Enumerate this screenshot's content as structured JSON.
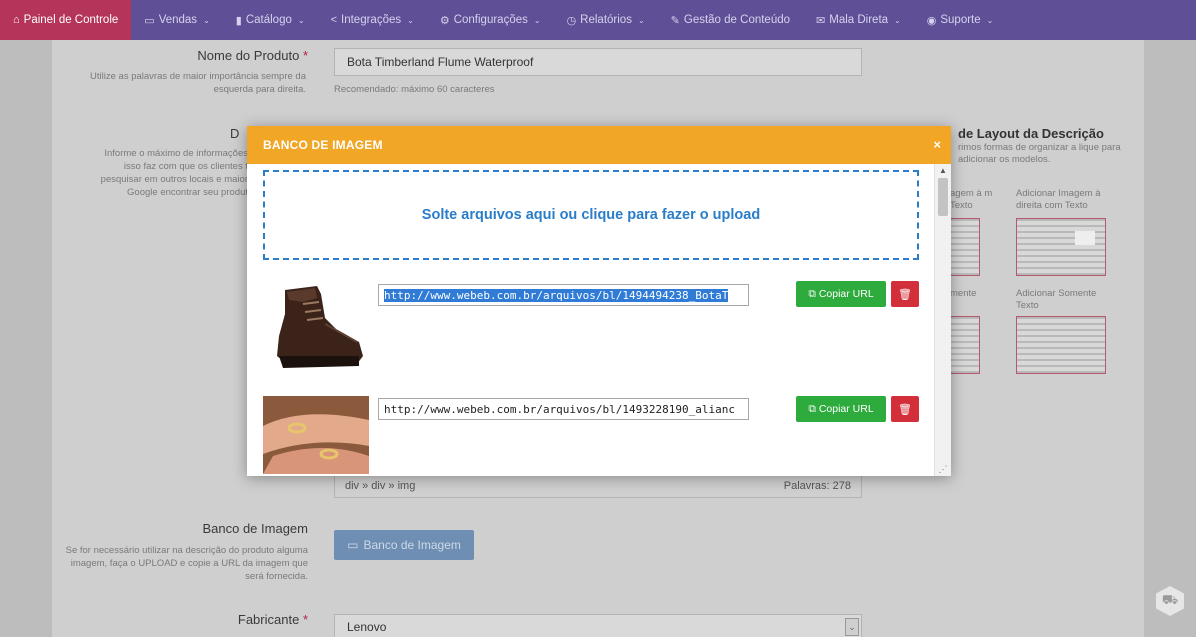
{
  "nav": {
    "items": [
      {
        "icon": "⌂",
        "label": "Painel de Controle",
        "caret": ""
      },
      {
        "icon": "▭",
        "label": "Vendas",
        "caret": "⌄"
      },
      {
        "icon": "▮",
        "label": "Catálogo",
        "caret": "⌄"
      },
      {
        "icon": "<",
        "label": "Integrações",
        "caret": "⌄"
      },
      {
        "icon": "⚙",
        "label": "Configurações",
        "caret": "⌄"
      },
      {
        "icon": "◷",
        "label": "Relatórios",
        "caret": "⌄"
      },
      {
        "icon": "✎",
        "label": "Gestão de Conteúdo",
        "caret": ""
      },
      {
        "icon": "✉",
        "label": "Mala Direta",
        "caret": "⌄"
      },
      {
        "icon": "◉",
        "label": "Suporte",
        "caret": "⌄"
      }
    ]
  },
  "form": {
    "product_name": {
      "label": "Nome do Produto",
      "required": "*",
      "hint": "Utilize as palavras de maior importância sempre da esquerda para direita.",
      "value": "Bota Timberland Flume Waterproof",
      "note": "Recomendado: máximo 60 caracteres"
    },
    "description": {
      "label_fragment": "D",
      "hint_lines": [
        "Informe o máximo de informações",
        "isso faz com que os clientes t",
        "pesquisar em outros locais e maior",
        "Google encontrar seu produt"
      ]
    },
    "layout": {
      "title": "de Layout da Descrição",
      "subtitle": "rimos formas de organizar a lique para adicionar os modelos.",
      "templates": [
        {
          "label": "agem à m Texto"
        },
        {
          "label": "Adicionar Imagem à direita com Texto"
        },
        {
          "label": "mente"
        },
        {
          "label": "Adicionar Somente Texto"
        }
      ]
    },
    "path": {
      "value": "div » div » img",
      "words": "Palavras: 278"
    },
    "image_bank": {
      "label": "Banco de Imagem",
      "hint": "Se for necessário utilizar na descrição do produto alguma imagem, faça o UPLOAD e copie a URL da imagem que será fornecida.",
      "button": "Banco de Imagem"
    },
    "manufacturer": {
      "label": "Fabricante",
      "required": "*",
      "value": "Lenovo"
    }
  },
  "modal": {
    "title": "BANCO DE IMAGEM",
    "close": "×",
    "dropzone": "Solte arquivos aqui ou clique para fazer o upload",
    "items": [
      {
        "url": "http://www.webeb.com.br/arquivos/bl/1494494238_BotaT",
        "copy_label": "Copiar URL",
        "delete_icon": "trash-icon",
        "selected": true
      },
      {
        "url": "http://www.webeb.com.br/arquivos/bl/1493228190_alianc",
        "copy_label": "Copiar URL",
        "delete_icon": "trash-icon",
        "selected": false
      }
    ]
  },
  "colors": {
    "nav_bg": "#5f4f96",
    "nav_active": "#b5345a",
    "modal_header": "#f2a625",
    "dropzone": "#2a7dc9",
    "copy_button": "#2eab3d",
    "delete_button": "#d32f3a",
    "selection": "#2f7bd6"
  }
}
